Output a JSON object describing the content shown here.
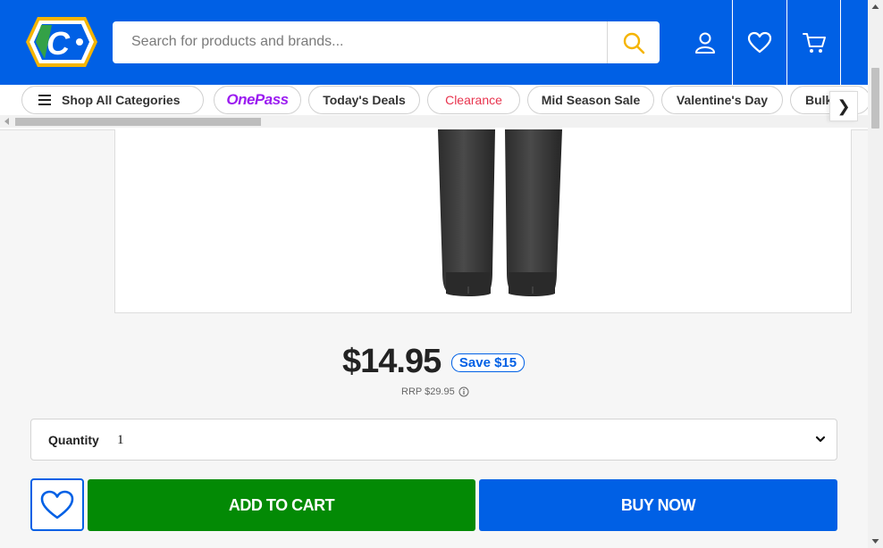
{
  "header": {
    "logo_letter": "C",
    "search": {
      "placeholder": "Search for products and brands..."
    },
    "icons": [
      "account-icon",
      "wishlist-icon",
      "cart-icon"
    ]
  },
  "nav": {
    "categories_label": "Shop All Categories",
    "pills": [
      "OnePass",
      "Today's Deals",
      "Clearance",
      "Mid Season Sale",
      "Valentine's Day",
      "Bulk"
    ],
    "next_arrow": "❯"
  },
  "product": {
    "price": "$14.95",
    "save": "Save $15",
    "rrp": "RRP $29.95"
  },
  "quantity": {
    "label": "Quantity",
    "value": "1"
  },
  "actions": {
    "add_to_cart": "ADD TO CART",
    "buy_now": "BUY NOW"
  },
  "colors": {
    "brand_blue": "#0060e5",
    "cart_green": "#038a05",
    "clearance_red": "#e8344e",
    "onepass_purple": "#9b1cf0",
    "search_icon_yellow": "#f5b400"
  }
}
